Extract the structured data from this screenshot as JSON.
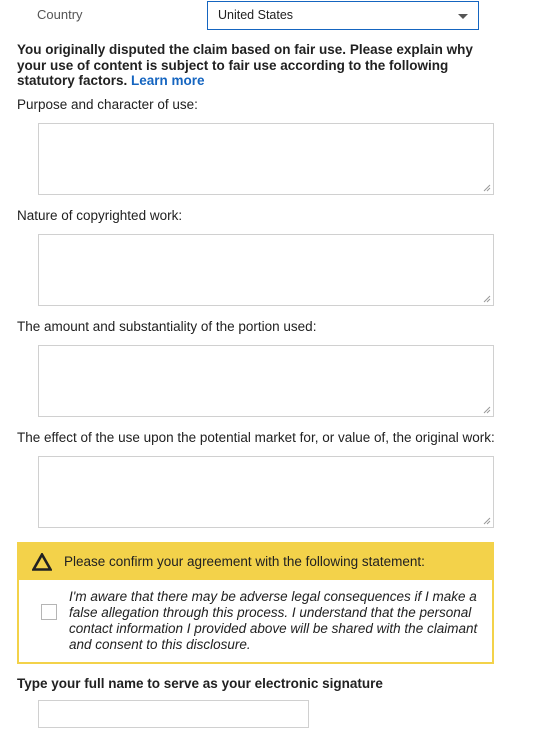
{
  "country": {
    "label": "Country",
    "selected": "United States"
  },
  "intro": {
    "text": "You originally disputed the claim based on fair use. Please explain why your use of content is subject to fair use according to the following statutory factors. ",
    "link": "Learn more"
  },
  "factors": [
    {
      "label": "Purpose and character of use:"
    },
    {
      "label": "Nature of copyrighted work:"
    },
    {
      "label": "The amount and substantiality of the portion used:"
    },
    {
      "label": "The effect of the use upon the potential market for, or value of, the original work:"
    }
  ],
  "confirmation": {
    "icon": "warning-icon",
    "title": "Please confirm your agreement with the following statement:",
    "statement": "I'm aware that there may be adverse legal consequences if I make a false allegation through this process. I understand that the personal contact information I provided above will be shared with the claimant and consent to this disclosure.",
    "checked": false
  },
  "signature": {
    "label": "Type your full name to serve as your electronic signature",
    "value": ""
  },
  "colors": {
    "accent": "#1565c0",
    "warning_band": "#f3d24a"
  }
}
